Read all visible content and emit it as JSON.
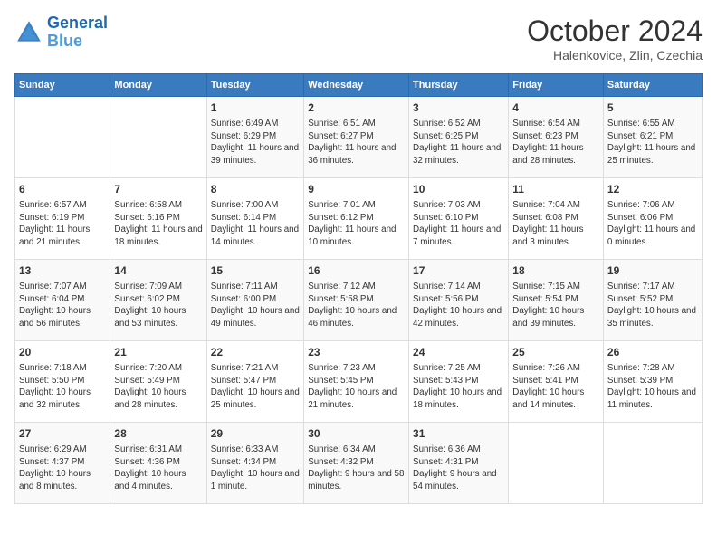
{
  "header": {
    "logo_line1": "General",
    "logo_line2": "Blue",
    "month": "October 2024",
    "location": "Halenkovice, Zlin, Czechia"
  },
  "days_of_week": [
    "Sunday",
    "Monday",
    "Tuesday",
    "Wednesday",
    "Thursday",
    "Friday",
    "Saturday"
  ],
  "weeks": [
    [
      {
        "day": "",
        "info": ""
      },
      {
        "day": "",
        "info": ""
      },
      {
        "day": "1",
        "info": "Sunrise: 6:49 AM\nSunset: 6:29 PM\nDaylight: 11 hours and 39 minutes."
      },
      {
        "day": "2",
        "info": "Sunrise: 6:51 AM\nSunset: 6:27 PM\nDaylight: 11 hours and 36 minutes."
      },
      {
        "day": "3",
        "info": "Sunrise: 6:52 AM\nSunset: 6:25 PM\nDaylight: 11 hours and 32 minutes."
      },
      {
        "day": "4",
        "info": "Sunrise: 6:54 AM\nSunset: 6:23 PM\nDaylight: 11 hours and 28 minutes."
      },
      {
        "day": "5",
        "info": "Sunrise: 6:55 AM\nSunset: 6:21 PM\nDaylight: 11 hours and 25 minutes."
      }
    ],
    [
      {
        "day": "6",
        "info": "Sunrise: 6:57 AM\nSunset: 6:19 PM\nDaylight: 11 hours and 21 minutes."
      },
      {
        "day": "7",
        "info": "Sunrise: 6:58 AM\nSunset: 6:16 PM\nDaylight: 11 hours and 18 minutes."
      },
      {
        "day": "8",
        "info": "Sunrise: 7:00 AM\nSunset: 6:14 PM\nDaylight: 11 hours and 14 minutes."
      },
      {
        "day": "9",
        "info": "Sunrise: 7:01 AM\nSunset: 6:12 PM\nDaylight: 11 hours and 10 minutes."
      },
      {
        "day": "10",
        "info": "Sunrise: 7:03 AM\nSunset: 6:10 PM\nDaylight: 11 hours and 7 minutes."
      },
      {
        "day": "11",
        "info": "Sunrise: 7:04 AM\nSunset: 6:08 PM\nDaylight: 11 hours and 3 minutes."
      },
      {
        "day": "12",
        "info": "Sunrise: 7:06 AM\nSunset: 6:06 PM\nDaylight: 11 hours and 0 minutes."
      }
    ],
    [
      {
        "day": "13",
        "info": "Sunrise: 7:07 AM\nSunset: 6:04 PM\nDaylight: 10 hours and 56 minutes."
      },
      {
        "day": "14",
        "info": "Sunrise: 7:09 AM\nSunset: 6:02 PM\nDaylight: 10 hours and 53 minutes."
      },
      {
        "day": "15",
        "info": "Sunrise: 7:11 AM\nSunset: 6:00 PM\nDaylight: 10 hours and 49 minutes."
      },
      {
        "day": "16",
        "info": "Sunrise: 7:12 AM\nSunset: 5:58 PM\nDaylight: 10 hours and 46 minutes."
      },
      {
        "day": "17",
        "info": "Sunrise: 7:14 AM\nSunset: 5:56 PM\nDaylight: 10 hours and 42 minutes."
      },
      {
        "day": "18",
        "info": "Sunrise: 7:15 AM\nSunset: 5:54 PM\nDaylight: 10 hours and 39 minutes."
      },
      {
        "day": "19",
        "info": "Sunrise: 7:17 AM\nSunset: 5:52 PM\nDaylight: 10 hours and 35 minutes."
      }
    ],
    [
      {
        "day": "20",
        "info": "Sunrise: 7:18 AM\nSunset: 5:50 PM\nDaylight: 10 hours and 32 minutes."
      },
      {
        "day": "21",
        "info": "Sunrise: 7:20 AM\nSunset: 5:49 PM\nDaylight: 10 hours and 28 minutes."
      },
      {
        "day": "22",
        "info": "Sunrise: 7:21 AM\nSunset: 5:47 PM\nDaylight: 10 hours and 25 minutes."
      },
      {
        "day": "23",
        "info": "Sunrise: 7:23 AM\nSunset: 5:45 PM\nDaylight: 10 hours and 21 minutes."
      },
      {
        "day": "24",
        "info": "Sunrise: 7:25 AM\nSunset: 5:43 PM\nDaylight: 10 hours and 18 minutes."
      },
      {
        "day": "25",
        "info": "Sunrise: 7:26 AM\nSunset: 5:41 PM\nDaylight: 10 hours and 14 minutes."
      },
      {
        "day": "26",
        "info": "Sunrise: 7:28 AM\nSunset: 5:39 PM\nDaylight: 10 hours and 11 minutes."
      }
    ],
    [
      {
        "day": "27",
        "info": "Sunrise: 6:29 AM\nSunset: 4:37 PM\nDaylight: 10 hours and 8 minutes."
      },
      {
        "day": "28",
        "info": "Sunrise: 6:31 AM\nSunset: 4:36 PM\nDaylight: 10 hours and 4 minutes."
      },
      {
        "day": "29",
        "info": "Sunrise: 6:33 AM\nSunset: 4:34 PM\nDaylight: 10 hours and 1 minute."
      },
      {
        "day": "30",
        "info": "Sunrise: 6:34 AM\nSunset: 4:32 PM\nDaylight: 9 hours and 58 minutes."
      },
      {
        "day": "31",
        "info": "Sunrise: 6:36 AM\nSunset: 4:31 PM\nDaylight: 9 hours and 54 minutes."
      },
      {
        "day": "",
        "info": ""
      },
      {
        "day": "",
        "info": ""
      }
    ]
  ]
}
